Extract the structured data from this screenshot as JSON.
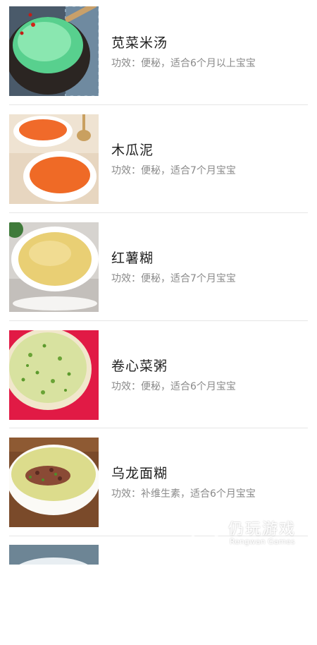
{
  "recipes": [
    {
      "title": "苋菜米汤",
      "desc": "功效：便秘，适合6个月以上宝宝"
    },
    {
      "title": "木瓜泥",
      "desc": "功效：便秘，适合7个月宝宝"
    },
    {
      "title": "红薯糊",
      "desc": "功效：便秘，适合7个月宝宝"
    },
    {
      "title": "卷心菜粥",
      "desc": "功效：便秘，适合6个月宝宝"
    },
    {
      "title": "乌龙面糊",
      "desc": "功效：补维生素，适合6个月宝宝"
    }
  ],
  "watermark": {
    "title": "仍玩游戏",
    "subtitle": "Rengwan Games"
  }
}
